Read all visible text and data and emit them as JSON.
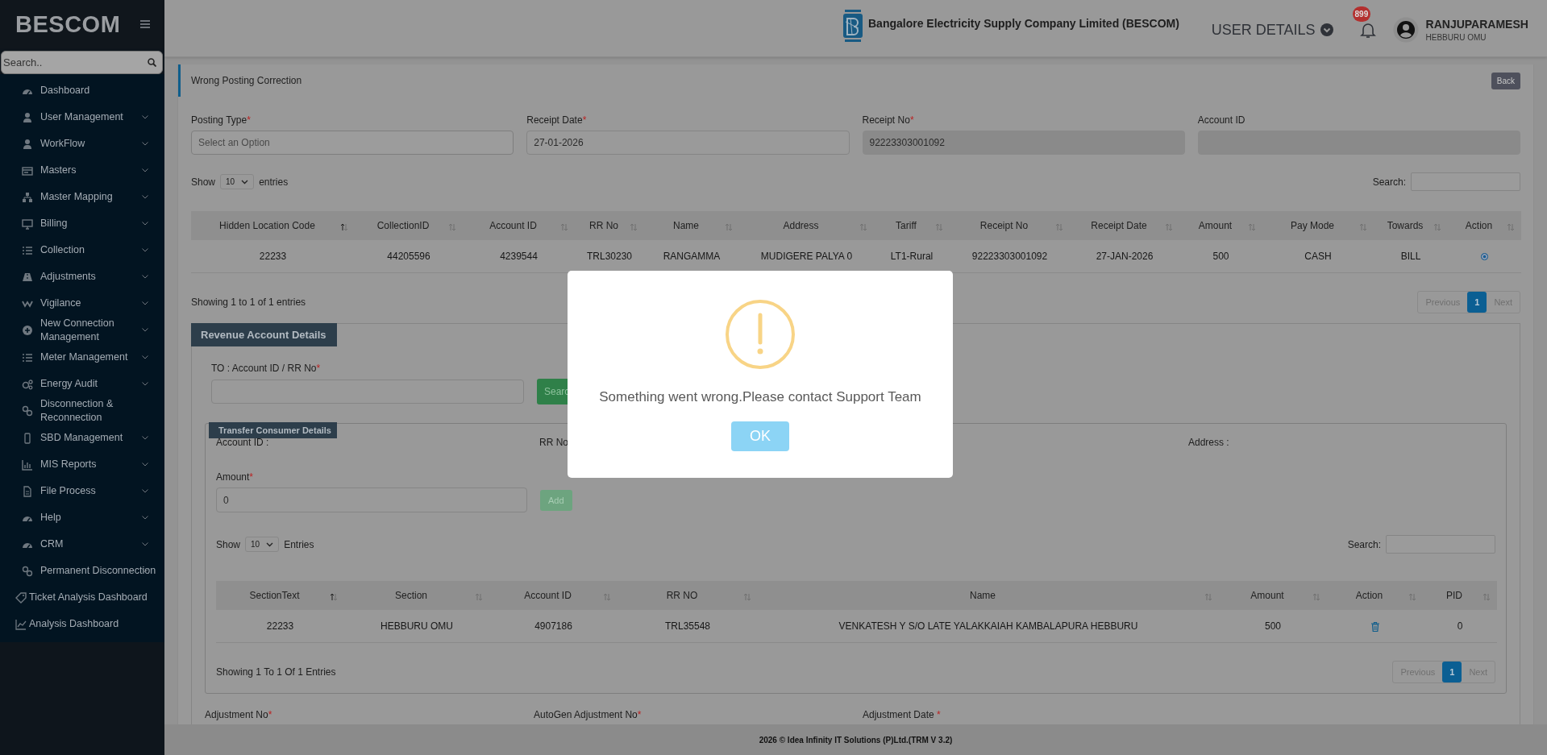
{
  "sidebar": {
    "brand": "BESCOM",
    "search": {
      "placeholder": "Search.."
    },
    "items": [
      {
        "label": "Dashboard",
        "expandable": false
      },
      {
        "label": "User Management",
        "expandable": true
      },
      {
        "label": "WorkFlow",
        "expandable": true
      },
      {
        "label": "Masters",
        "expandable": true
      },
      {
        "label": "Master Mapping",
        "expandable": true
      },
      {
        "label": "Billing",
        "expandable": true
      },
      {
        "label": "Collection",
        "expandable": true
      },
      {
        "label": "Adjustments",
        "expandable": true
      },
      {
        "label": "Vigilance",
        "expandable": true
      },
      {
        "label": "New Connection Management",
        "expandable": true
      },
      {
        "label": "Meter Management",
        "expandable": true
      },
      {
        "label": "Energy Audit",
        "expandable": true
      },
      {
        "label": "Disconnection & Reconnection",
        "expandable": false
      },
      {
        "label": "SBD Management",
        "expandable": true
      },
      {
        "label": "MIS Reports",
        "expandable": true
      },
      {
        "label": "File Process",
        "expandable": true
      },
      {
        "label": "Help",
        "expandable": true
      },
      {
        "label": "CRM",
        "expandable": true
      },
      {
        "label": "Permanent Disconnection",
        "expandable": true
      },
      {
        "label": "Ticket Analysis Dashboard",
        "expandable": false
      },
      {
        "label": "Analysis Dashboard",
        "expandable": false
      }
    ]
  },
  "header": {
    "company": "Bangalore Electricity Supply Company Limited (BESCOM)",
    "user_details": "USER DETAILS",
    "notifications": "899",
    "user": {
      "name": "RANJUPARAMESH",
      "office": "HEBBURU OMU"
    }
  },
  "page": {
    "title": "Wrong Posting Correction",
    "back": "Back"
  },
  "form": [
    {
      "label": "Posting Type",
      "mark": "*",
      "kind": "select",
      "placeholder": "Select an Option",
      "disabled": false
    },
    {
      "label": "Receipt Date",
      "mark": "*",
      "kind": "input",
      "value": "27-01-2026",
      "disabled": false
    },
    {
      "label": "Receipt No",
      "mark": "*",
      "kind": "input",
      "value": "92223303001092",
      "disabled": true
    },
    {
      "label": "Account ID",
      "kind": "input",
      "disabled": true
    }
  ],
  "receipts": {
    "show": "Show",
    "page_size": "10",
    "entries": "entries",
    "search_label": "Search:",
    "columns": [
      {
        "label": "Hidden Location Code",
        "sorted": true
      },
      {
        "label": "CollectionID",
        "sorted": false
      },
      {
        "label": "Account ID",
        "sorted": false
      },
      {
        "label": "RR No",
        "sorted": false
      },
      {
        "label": "Name",
        "sorted": false
      },
      {
        "label": "Address",
        "sorted": false
      },
      {
        "label": "Tariff",
        "sorted": false
      },
      {
        "label": "Receipt No",
        "sorted": false
      },
      {
        "label": "Receipt Date",
        "sorted": false
      },
      {
        "label": "Amount",
        "sorted": false
      },
      {
        "label": "Pay Mode",
        "sorted": false
      },
      {
        "label": "Towards",
        "sorted": false
      },
      {
        "label": "Action",
        "sorted": false
      }
    ],
    "rows": [
      {
        "cells": [
          "22233",
          "44205596",
          "4239544",
          "TRL30230",
          "RANGAMMA",
          "MUDIGERE PALYA 0",
          "LT1-Rural",
          "92223303001092",
          "27-JAN-2026",
          "500",
          "CASH",
          "BILL",
          {
            "kind": "radio",
            "selected": true
          }
        ]
      }
    ],
    "info": "Showing 1 to 1 of 1 entries",
    "pagination": [
      {
        "label": "Previous",
        "selected": false,
        "disabled": true
      },
      {
        "label": "1",
        "selected": true,
        "disabled": false
      },
      {
        "label": "Next",
        "selected": false,
        "disabled": true
      }
    ]
  },
  "revenue": {
    "title": "Revenue Account Details",
    "to_label": "TO : Account ID / RR No",
    "to_mark": "*",
    "search_button": "Searc",
    "transfer": {
      "title": "Transfer Consumer Details",
      "account_label": "Account ID :",
      "rr_label": "RR No",
      "address_label": "Address :",
      "amount_label": "Amount",
      "amount_mark": "*",
      "amount_value": "0",
      "add_button": "Add",
      "show": "Show",
      "page_size": "10",
      "entries": "Entries",
      "search_label": "Search:",
      "columns": [
        {
          "label": "SectionText",
          "sorted": true
        },
        {
          "label": "Section",
          "sorted": false
        },
        {
          "label": "Account ID",
          "sorted": false
        },
        {
          "label": "RR NO",
          "sorted": false
        },
        {
          "label": "Name",
          "sorted": false
        },
        {
          "label": "Amount",
          "sorted": false
        },
        {
          "label": "Action",
          "sorted": false
        },
        {
          "label": "PID",
          "sorted": false
        }
      ],
      "rows": [
        {
          "cells": [
            "22233",
            "HEBBURU OMU",
            "4907186",
            "TRL35548",
            "VENKATESH Y S/O LATE YALAKKAIAH KAMBALAPURA HEBBURU",
            "500",
            {
              "kind": "delete"
            },
            "0"
          ]
        }
      ],
      "info": "Showing 1 To 1 Of 1 Entries",
      "pagination": [
        {
          "label": "Previous",
          "selected": false,
          "disabled": true
        },
        {
          "label": "1",
          "selected": true,
          "disabled": false
        },
        {
          "label": "Next",
          "selected": false,
          "disabled": true
        }
      ]
    },
    "adjustments": [
      {
        "label": "Adjustment No",
        "mark": "*"
      },
      {
        "label": "AutoGen Adjustment No",
        "mark": "*"
      },
      {
        "label": "Adjustment Date",
        "mark": " *"
      }
    ]
  },
  "footer": "2026 © Idea Infinity IT Solutions (P)Ltd.(TRM V 3.2)",
  "modal": {
    "message": "Something went wrong.Please contact Support Team",
    "ok": "OK"
  }
}
